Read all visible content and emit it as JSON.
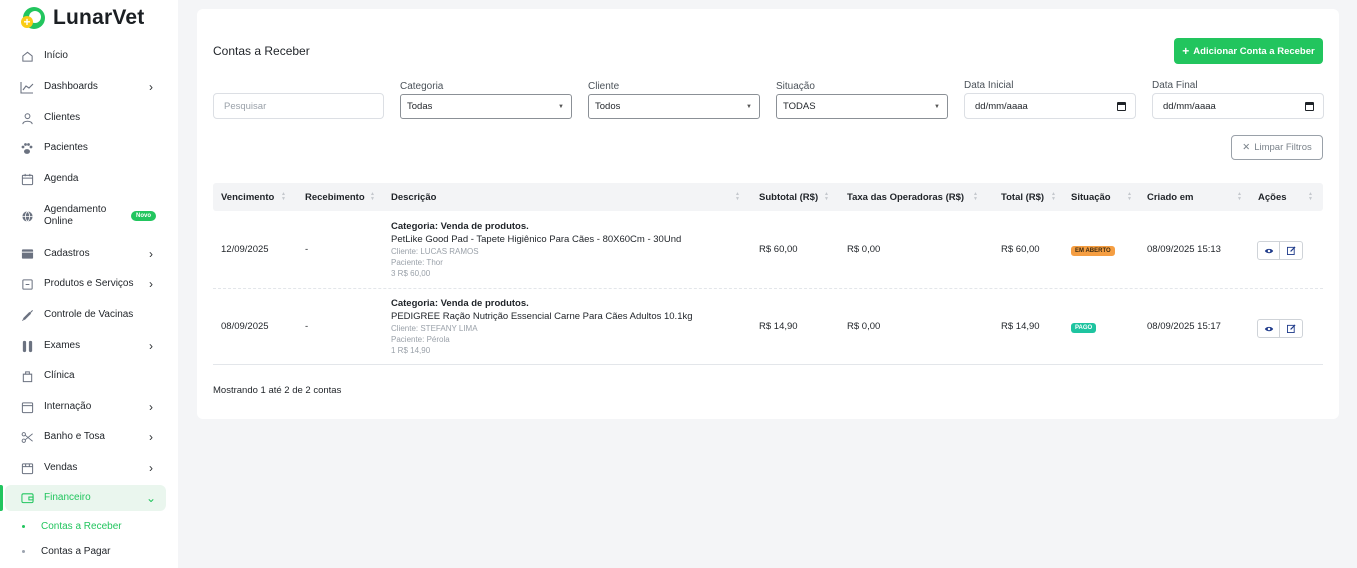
{
  "app": {
    "name": "LunarVet"
  },
  "sidebar": {
    "items": [
      {
        "label": "Início",
        "icon": "home-icon"
      },
      {
        "label": "Dashboards",
        "icon": "chart-line-icon"
      },
      {
        "label": "Clientes",
        "icon": "user-icon"
      },
      {
        "label": "Pacientes",
        "icon": "paw-icon"
      },
      {
        "label": "Agenda",
        "icon": "calendar-icon"
      },
      {
        "label": "Agendamento Online",
        "icon": "globe-icon",
        "badge": "Novo"
      },
      {
        "label": "Cadastros",
        "icon": "box-icon"
      },
      {
        "label": "Produtos e Serviços",
        "icon": "tag-icon"
      },
      {
        "label": "Controle de Vacinas",
        "icon": "syringe-icon"
      },
      {
        "label": "Exames",
        "icon": "test-tube-icon"
      },
      {
        "label": "Clínica",
        "icon": "clinic-icon"
      },
      {
        "label": "Internação",
        "icon": "hospital-icon"
      },
      {
        "label": "Banho e Tosa",
        "icon": "scissors-icon"
      },
      {
        "label": "Vendas",
        "icon": "cart-icon"
      },
      {
        "label": "Financeiro",
        "icon": "wallet-icon"
      }
    ],
    "sub_items": [
      "Contas a Receber",
      "Contas a Pagar"
    ]
  },
  "page": {
    "title": "Contas a Receber",
    "add_button": "Adicionar Conta a Receber",
    "search_placeholder": "Pesquisar",
    "clear_button": "Limpar Filtros"
  },
  "filters": {
    "categoria": {
      "label": "Categoria",
      "value": "Todas"
    },
    "cliente": {
      "label": "Cliente",
      "value": "Todos"
    },
    "situacao": {
      "label": "Situação",
      "value": "TODAS"
    },
    "data_inicial": {
      "label": "Data Inicial",
      "value": "dd/mm/aaaa"
    },
    "data_final": {
      "label": "Data Final",
      "value": "dd/mm/aaaa"
    }
  },
  "table": {
    "columns": [
      "Vencimento",
      "Recebimento",
      "Descrição",
      "Subtotal (R$)",
      "Taxa das Operadoras (R$)",
      "Total (R$)",
      "Situação",
      "Criado em",
      "Ações"
    ],
    "rows": [
      {
        "vencimento": "12/09/2025",
        "recebimento": "-",
        "categoria": "Categoria: Venda de produtos.",
        "produto": "PetLike Good Pad - Tapete Higiênico Para Cães - 80X60Cm - 30Und",
        "cliente": "Cliente: LUCAS RAMOS",
        "paciente": "Paciente: Thor",
        "qtd": "3 R$ 60,00",
        "subtotal": "R$ 60,00",
        "taxa": "R$ 0,00",
        "total": "R$ 60,00",
        "situacao": "EM ABERTO",
        "criado": "08/09/2025 15:13"
      },
      {
        "vencimento": "08/09/2025",
        "recebimento": "-",
        "categoria": "Categoria: Venda de produtos.",
        "produto": "PEDIGREE Ração Nutrição Essencial Carne Para Cães Adultos 10.1kg",
        "cliente": "Cliente: STEFANY LIMA",
        "paciente": "Paciente: Pérola",
        "qtd": "1 R$ 14,90",
        "subtotal": "R$ 14,90",
        "taxa": "R$ 0,00",
        "total": "R$ 14,90",
        "situacao": "PAGO",
        "criado": "08/09/2025 15:17"
      }
    ],
    "footer": "Mostrando 1 até 2 de 2 contas"
  },
  "colors": {
    "accent": "#22c55e",
    "open": "#f59e42",
    "paid": "#1ec4a0"
  }
}
